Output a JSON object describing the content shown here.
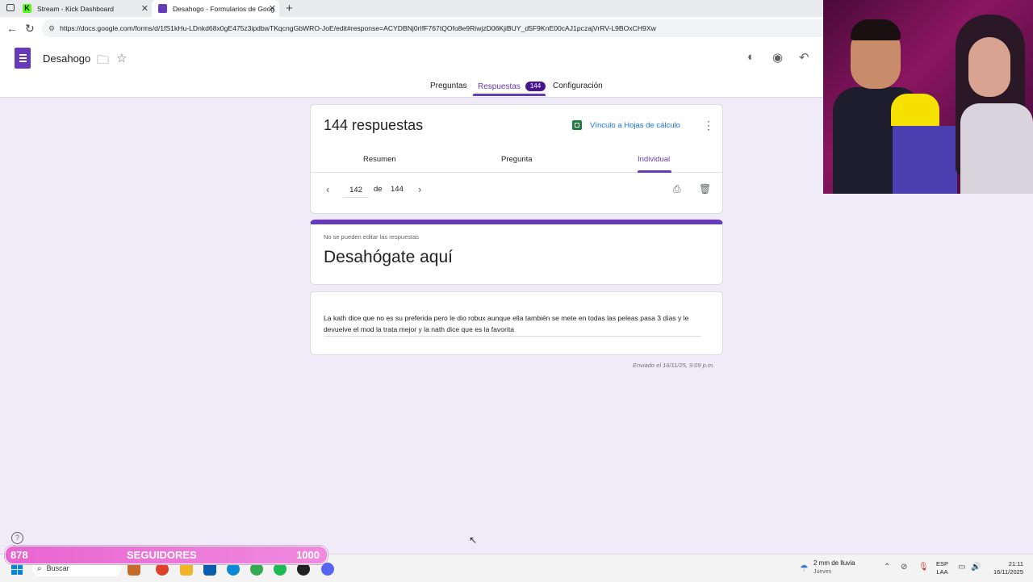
{
  "browser": {
    "tabs": [
      {
        "label": "Stream - Kick Dashboard",
        "favicon": "K"
      },
      {
        "label": "Desahogo - Formularios de Goog"
      }
    ],
    "url": "https://docs.google.com/forms/d/1fS1kHu-LDnkd68x0gE475z3ipdbwTKqcngGbWRO-JoE/edit#response=ACYDBNj0rIfF767tQOfo8e9RiwjzD06KjiBUY_d5F9KnE00cAJ1pczajVrRV-L9BOxCH9Xw"
  },
  "form": {
    "title": "Desahogo",
    "nav_tabs": {
      "questions": "Preguntas",
      "responses": "Respuestas",
      "responses_count": "144",
      "settings": "Configuración"
    }
  },
  "responses": {
    "heading": "144 respuestas",
    "sheets_link": "Vínculo a Hojas de cálculo",
    "views": {
      "summary": "Resumen",
      "question": "Pregunta",
      "individual": "Individual"
    },
    "pager": {
      "current": "142",
      "of": "de",
      "total": "144"
    }
  },
  "response_view": {
    "note": "No se pueden editar las respuestas",
    "form_title": "Desahógate aquí",
    "answer": "La kath dice que no es su preferida pero le dio robux aunque ella también se mete en todas las peleas pasa 3 días y le devuelve el mod la trata mejor y la nath dice que es la favorita",
    "sent": "Enviado el 16/11/25, 9:09 p.m."
  },
  "overlay": {
    "followers_current": "878",
    "followers_label": "SEGUIDORES",
    "followers_goal": "1000",
    "progress": 0.878
  },
  "taskbar": {
    "search": "Buscar",
    "weather_line1": "2 mm de lluvia",
    "weather_line2": "Jueves",
    "lang1": "ESP",
    "lang2": "LAA",
    "time": "21:11",
    "date": "16/11/2025"
  },
  "colors": {
    "accent": "#673ab7",
    "sheets_green": "#188038",
    "overlay_pink": "#e864d0"
  }
}
